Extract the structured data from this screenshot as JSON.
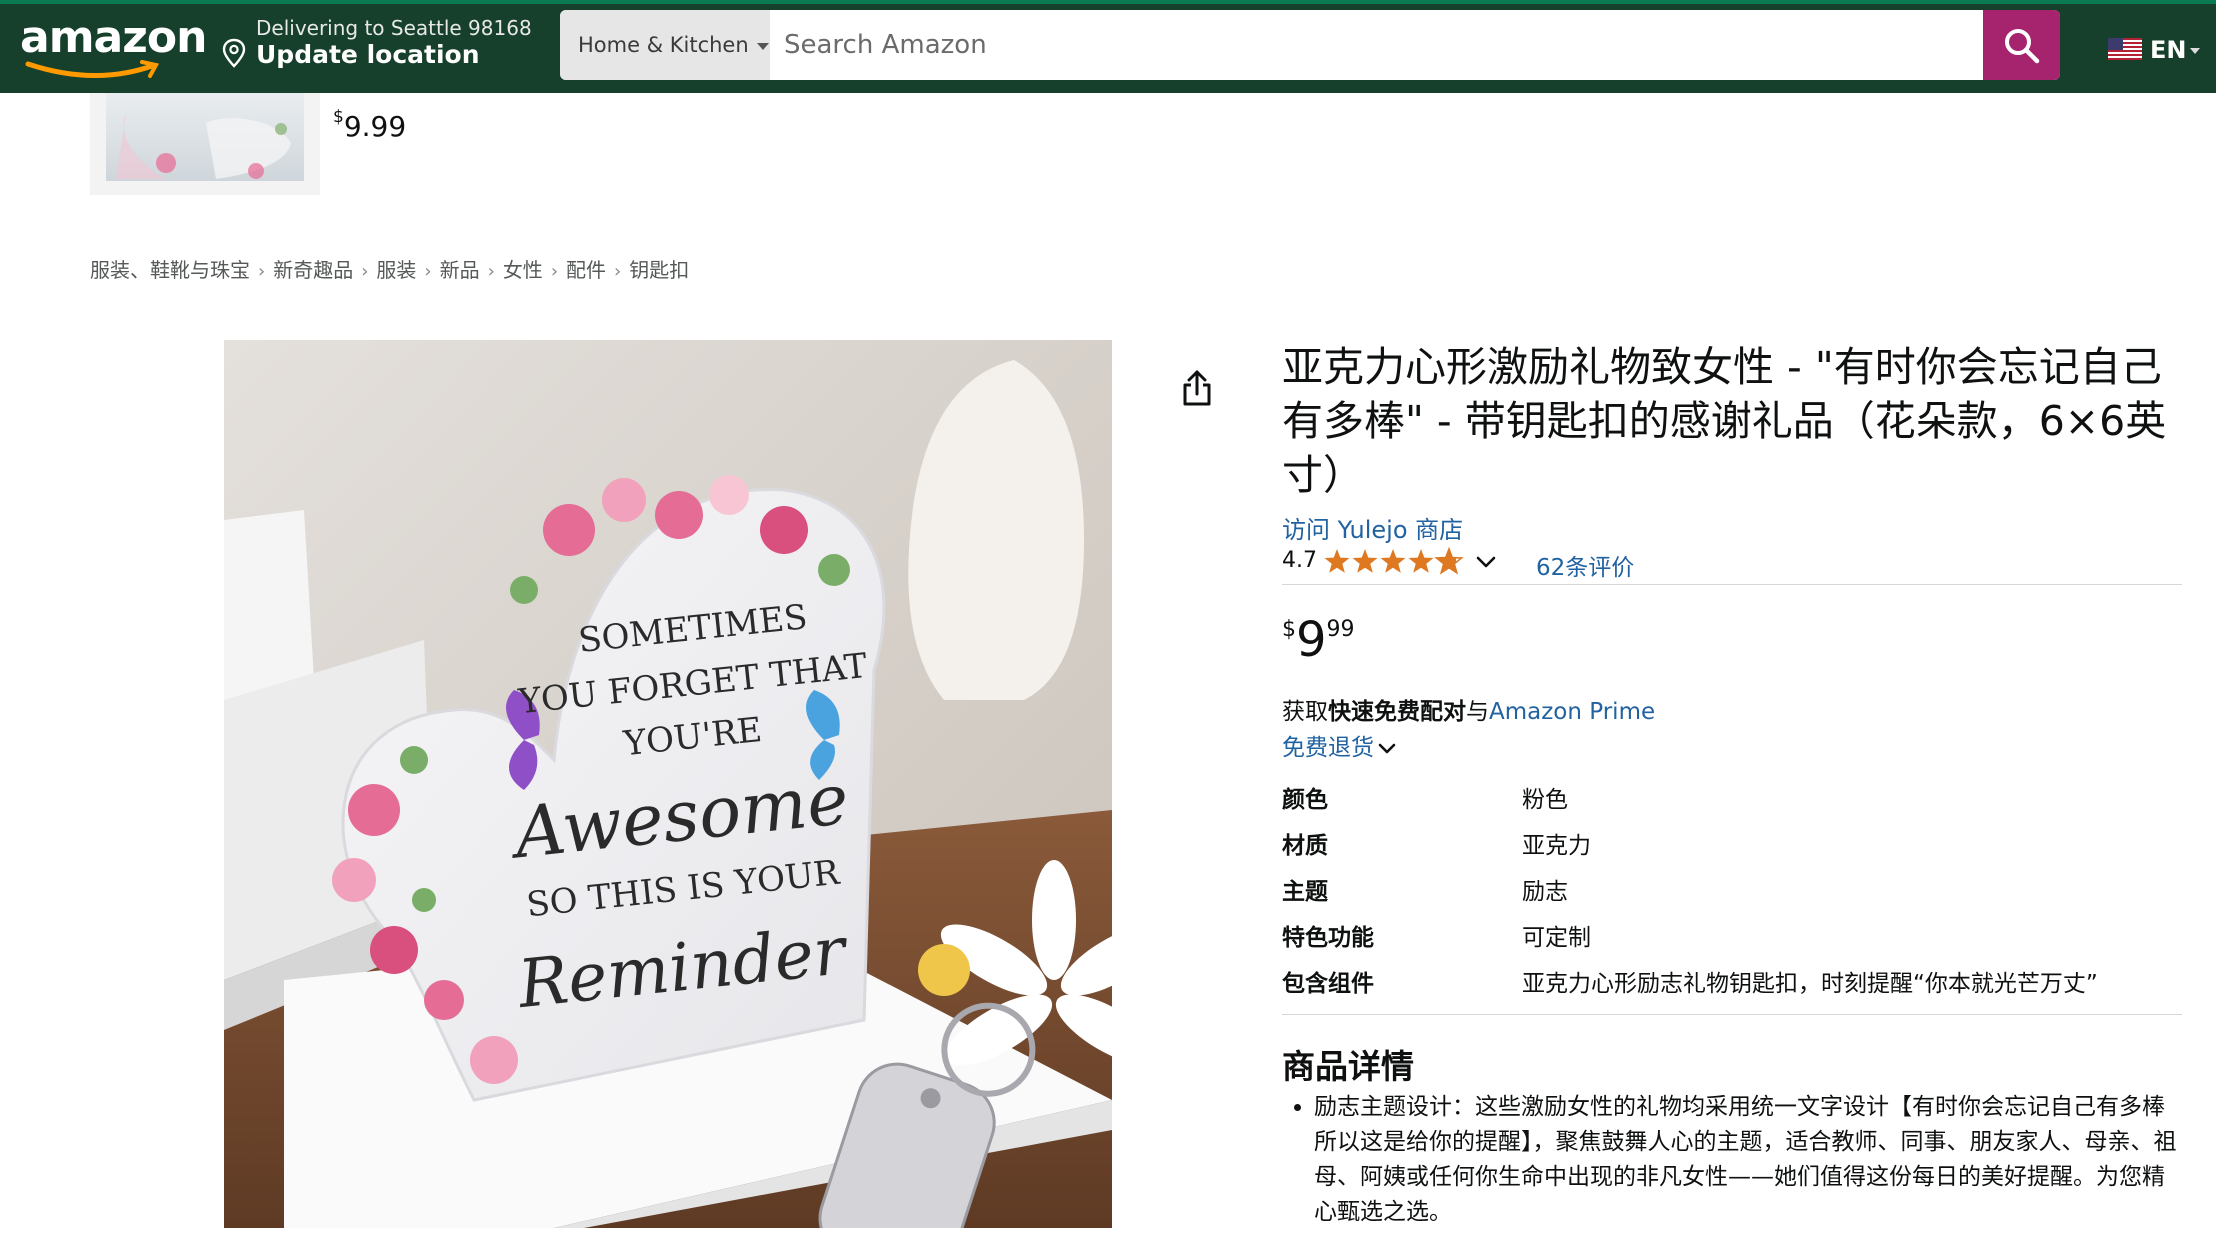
{
  "header": {
    "logo": "amazon",
    "deliver_line1": "Delivering to Seattle 98168",
    "deliver_line2": "Update location",
    "search_department": "Home & Kitchen",
    "search_placeholder": "Search Amazon",
    "language": "EN"
  },
  "mini_product": {
    "price_currency": "$",
    "price_value": "9.99"
  },
  "breadcrumb": [
    "服装、鞋靴与珠宝",
    "新奇趣品",
    "服装",
    "新品",
    "女性",
    "配件",
    "钥匙扣"
  ],
  "product": {
    "title": "亚克力心形激励礼物致女性 - \"有时你会忘记自己有多棒\" - 带钥匙扣的感谢礼品（花朵款，6×6英寸）",
    "store_link": "访问 Yulejo 商店",
    "rating": "4.7",
    "rating_value": 4.7,
    "review_count": "62条评价",
    "price_currency": "$",
    "price_whole": "9",
    "price_fraction": "99",
    "shipping_prefix": "获取",
    "shipping_bold": "快速免费配对",
    "shipping_mid": "与",
    "shipping_link": "Amazon Prime",
    "returns": "免费退货",
    "attributes": [
      {
        "key": "颜色",
        "value": "粉色"
      },
      {
        "key": "材质",
        "value": "亚克力"
      },
      {
        "key": "主题",
        "value": "励志"
      },
      {
        "key": "特色功能",
        "value": "可定制"
      },
      {
        "key": "包含组件",
        "value": "亚克力心形励志礼物钥匙扣，时刻提醒“你本就光芒万丈”"
      }
    ],
    "details_heading": "商品详情",
    "details_bullets": [
      "励志主题设计：这些激励女性的礼物均采用统一文字设计【有时你会忘记自己有多棒 所以这是给你的提醒】，聚焦鼓舞人心的主题，适合教师、同事、朋友家人、母亲、祖母、阿姨或任何你生命中出现的非凡女性——她们值得这份每日的美好提醒。为您精心甄选之选。"
    ]
  },
  "image_text": {
    "line1": "SOMETIMES",
    "line2": "YOU FORGET THAT",
    "line3": "YOU'RE",
    "line4": "Awesome",
    "line5": "SO THIS IS YOUR",
    "line6": "Reminder"
  },
  "colors": {
    "header_bg": "#16402c",
    "search_button": "#a6236e",
    "link": "#2162a1",
    "star": "#de7921"
  }
}
